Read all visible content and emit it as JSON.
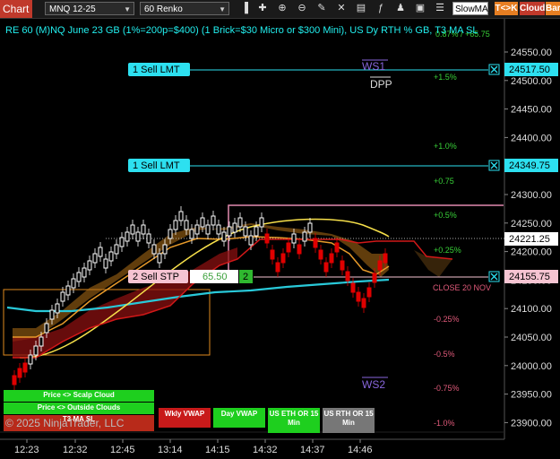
{
  "toolbar": {
    "chart_label": "Chart",
    "instrument": "MNQ 12-25",
    "interval": "60 Renko",
    "slowma_label": "SlowMA",
    "tk_label": "T<>K",
    "cloud_label": "Cloud",
    "bar_label": "Bar"
  },
  "chart": {
    "title": "RE 60 (M)NQ June 23 GB (1%=200p=$400) (1 Brick=$30 Micro or $300 Mini), US Dy RTH % GB, T3 MA SL",
    "copyright": "© 2025 NinjaTrader, LLC",
    "y_ticks": [
      "24550.00",
      "24500.00",
      "24450.00",
      "24400.00",
      "24350.00",
      "24300.00",
      "24250.00",
      "24200.00",
      "24150.00",
      "24100.00",
      "24050.00",
      "24000.00",
      "23950.00",
      "23900.00"
    ],
    "x_ticks": [
      "12:23",
      "12:32",
      "12:45",
      "13:14",
      "14:15",
      "14:32",
      "14:37",
      "14:46"
    ],
    "percent_labels": [
      {
        "text": "+1.5%",
        "color": "#38d038"
      },
      {
        "text": "+1.0%",
        "color": "#38d038"
      },
      {
        "text": "+0.75",
        "color": "#38d038"
      },
      {
        "text": "+0.5%",
        "color": "#38d038"
      },
      {
        "text": "+0.25%",
        "color": "#38d038"
      },
      {
        "text": "-0.25%",
        "color": "#e05a7a"
      },
      {
        "text": "-0.5%",
        "color": "#e05a7a"
      },
      {
        "text": "-0.75%",
        "color": "#e05a7a"
      },
      {
        "text": "-1.0%",
        "color": "#e05a7a"
      }
    ],
    "top_pct": "0.87% / +65.75",
    "ws1": "WS1",
    "dpp": "DPP",
    "ws2": "WS2",
    "close_label": "CLOSE 20 NOV",
    "current_price": "24221.25"
  },
  "orders": {
    "sell_lmt_1": {
      "label": "1 Sell LMT",
      "price": "24517.50"
    },
    "sell_lmt_2": {
      "label": "1 Sell LMT",
      "price": "24349.75"
    },
    "sell_stp": {
      "label": "2 Sell STP",
      "pnl": "65.50",
      "qty": "2",
      "price": "24155.75"
    }
  },
  "buttons": {
    "scalp_cloud": "Price <> Scalp Cloud",
    "outside_clouds": "Price <> Outside Clouds",
    "t3_sl": "T3 MA SL",
    "wkly_vwap": "Wkly VWAP",
    "day_vwap": "Day VWAP",
    "eth_or": "US ETH OR 15 Min",
    "rth_or": "US RTH OR 15 Min"
  },
  "colors": {
    "bg": "#000000",
    "up_brick": "#ffffff",
    "down_brick": "#e00000",
    "order_cyan": "#2de0f0",
    "stop_pink": "#f6c4d2",
    "cloud_orange": "#d4881a",
    "cloud_red": "#b81414"
  }
}
